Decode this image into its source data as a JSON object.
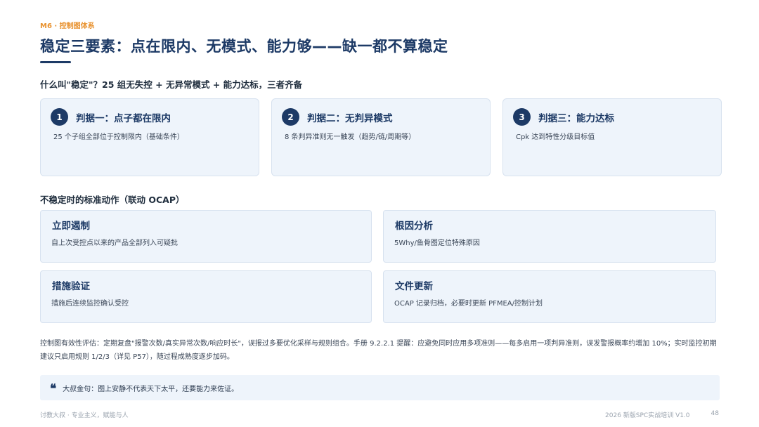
{
  "header": {
    "eyebrow": "M6 · 控制图体系",
    "title": "稳定三要素：点在限内、无模式、能力够——缺一都不算稳定"
  },
  "subtitle": "什么叫\"稳定\"？25 组无失控 + 无异常模式 + 能力达标，三者齐备",
  "criteria": [
    {
      "num": "1",
      "title": "判据一：点子都在限内",
      "desc": "25 个子组全部位于控制限内（基础条件）"
    },
    {
      "num": "2",
      "title": "判据二：无判异模式",
      "desc": "8 条判异准则无一触发（趋势/链/周期等）"
    },
    {
      "num": "3",
      "title": "判据三：能力达标",
      "desc": "Cpk 达到特性分级目标值"
    }
  ],
  "section2": "不稳定时的标准动作（联动 OCAP）",
  "actions": [
    {
      "title": "立即遏制",
      "desc": "自上次受控点以来的产品全部列入可疑批"
    },
    {
      "title": "根因分析",
      "desc": "5Why/鱼骨图定位特殊原因"
    },
    {
      "title": "措施验证",
      "desc": "措施后连续监控确认受控"
    },
    {
      "title": "文件更新",
      "desc": "OCAP 记录归档，必要时更新 PFMEA/控制计划"
    }
  ],
  "paragraph": "控制图有效性评估：定期复盘\"报警次数/真实异常次数/响应时长\"，误报过多要优化采样与规则组合。手册 9.2.2.1 提醒：应避免同时应用多项准则——每多启用一项判异准则，误发警报概率约增加 10%；实时监控初期建议只启用规则 1/2/3（详见 P57），随过程成熟度逐步加码。",
  "quote": {
    "icon": "quote-icon",
    "text": "大叔金句：图上安静不代表天下太平，还要能力来佐证。"
  },
  "footer": {
    "left": "讨教大叔 · 专业主义，赋能与人",
    "course": "2026 新版SPC实战培训 V1.0",
    "page": "48"
  }
}
